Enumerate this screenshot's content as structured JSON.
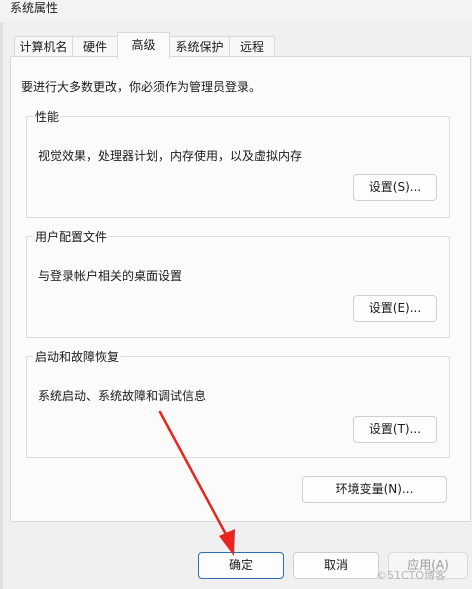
{
  "window": {
    "title": "系统属性"
  },
  "tabs": [
    "计算机名",
    "硬件",
    "高级",
    "系统保护",
    "远程"
  ],
  "admin_note": "要进行大多数更改，你必须作为管理员登录。",
  "groups": {
    "performance": {
      "legend": "性能",
      "desc": "视觉效果，处理器计划，内存使用，以及虚拟内存",
      "button": "设置(S)..."
    },
    "profiles": {
      "legend": "用户配置文件",
      "desc": "与登录帐户相关的桌面设置",
      "button": "设置(E)..."
    },
    "startup": {
      "legend": "启动和故障恢复",
      "desc": "系统启动、系统故障和调试信息",
      "button": "设置(T)..."
    }
  },
  "env_button": "环境变量(N)...",
  "footer": {
    "ok": "确定",
    "cancel": "取消",
    "apply": "应用(A)"
  },
  "watermark": "©51CTO博客",
  "colors": {
    "arrow": "#e8251f",
    "focus": "#2b6fb6"
  }
}
